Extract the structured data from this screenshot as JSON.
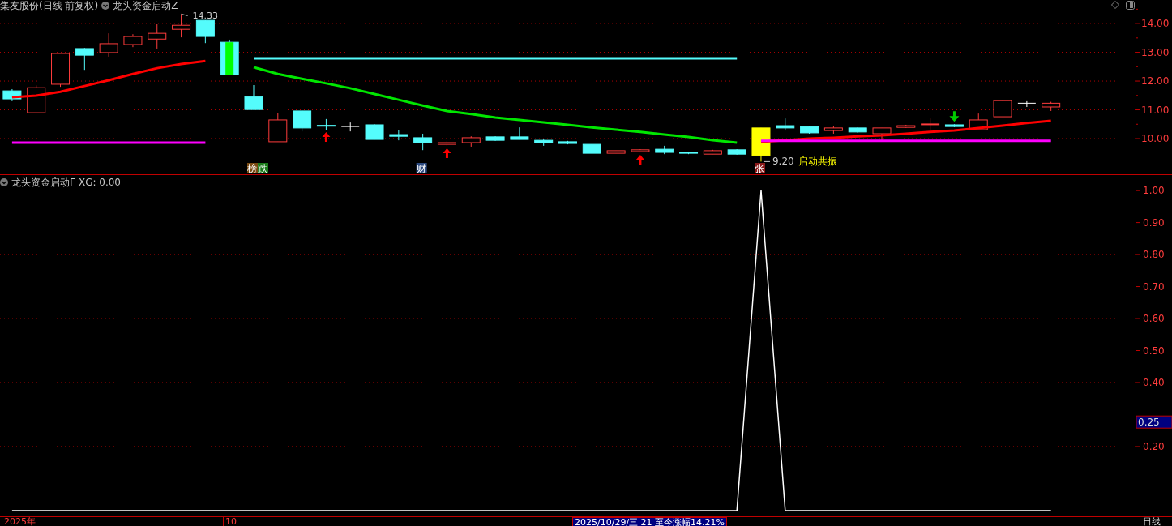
{
  "header": {
    "title": "集友股份(日线 前复权)",
    "indicator": "龙头资金启动Z"
  },
  "price_panel": {
    "chart_data": {
      "type": "line",
      "grid": true,
      "categories": [
        null,
        null,
        null,
        null,
        null,
        null,
        null,
        null,
        null,
        null,
        null,
        null,
        null,
        null,
        null,
        null,
        null,
        null,
        null,
        null,
        null,
        null,
        null,
        null,
        null,
        null,
        null,
        null,
        null,
        null,
        null,
        null,
        null,
        null,
        null,
        null,
        null,
        null,
        null,
        null,
        null,
        null,
        null,
        null,
        null,
        null,
        null
      ],
      "ylim": [
        8.76,
        14.82
      ],
      "yticks": [
        {
          "value": 10,
          "label": "10.00"
        },
        {
          "value": 11,
          "label": "11.00"
        },
        {
          "value": 12,
          "label": "12.00"
        },
        {
          "value": 13,
          "label": "13.00"
        },
        {
          "value": 14,
          "label": "14.00"
        }
      ],
      "series": [
        {
          "color": "#ff0000",
          "values": [
            11.44,
            11.49,
            11.63,
            11.83,
            12.03,
            12.25,
            12.45,
            12.59,
            12.7,
            null,
            null,
            null,
            null,
            null,
            null,
            null,
            null,
            null,
            null,
            null,
            null,
            null,
            null,
            null,
            null,
            null,
            null,
            null,
            null,
            null,
            null,
            null,
            null,
            null,
            null,
            null,
            null,
            null,
            null,
            null,
            null,
            null,
            null,
            null,
            null,
            null,
            null
          ]
        },
        {
          "color": "#00e600",
          "values": [
            null,
            null,
            null,
            null,
            null,
            null,
            null,
            null,
            null,
            null,
            12.48,
            12.25,
            12.08,
            11.92,
            11.75,
            11.55,
            11.35,
            11.15,
            10.96,
            10.85,
            10.73,
            10.65,
            10.56,
            10.48,
            10.39,
            10.31,
            10.23,
            10.14,
            10.06,
            9.94,
            9.86,
            null,
            null,
            null,
            null,
            null,
            null,
            null,
            null,
            null,
            null,
            null,
            null,
            null,
            null,
            null,
            null
          ]
        },
        {
          "color": "#ff0000",
          "values": [
            null,
            null,
            null,
            null,
            null,
            null,
            null,
            null,
            null,
            null,
            null,
            null,
            null,
            null,
            null,
            null,
            null,
            null,
            null,
            null,
            null,
            null,
            null,
            null,
            null,
            null,
            null,
            null,
            null,
            null,
            null,
            9.89,
            9.94,
            10.0,
            10.03,
            10.08,
            10.11,
            10.17,
            10.23,
            10.28,
            10.37,
            10.45,
            10.54,
            10.62,
            null,
            null,
            null
          ]
        },
        {
          "color": "#54fcfc",
          "values": [
            null,
            null,
            null,
            null,
            null,
            null,
            null,
            null,
            null,
            null,
            12.79,
            12.79,
            12.79,
            12.79,
            12.79,
            12.79,
            12.79,
            12.79,
            12.79,
            12.79,
            12.79,
            12.79,
            12.79,
            12.79,
            12.79,
            12.79,
            12.79,
            12.79,
            12.79,
            12.79,
            12.79,
            null,
            null,
            null,
            null,
            null,
            null,
            null,
            null,
            null,
            null,
            null,
            null,
            null,
            null,
            null,
            null
          ]
        },
        {
          "color": "#ff00ff",
          "values": [
            9.86,
            9.86,
            9.86,
            9.86,
            9.86,
            9.86,
            9.86,
            9.86,
            9.86,
            null,
            null,
            null,
            null,
            null,
            null,
            null,
            null,
            null,
            null,
            null,
            null,
            null,
            null,
            null,
            null,
            null,
            null,
            null,
            null,
            null,
            null,
            9.92,
            9.92,
            9.92,
            9.92,
            9.92,
            9.92,
            9.92,
            9.92,
            9.92,
            9.92,
            9.92,
            9.92,
            9.92,
            null,
            null,
            null
          ]
        }
      ]
    },
    "tags": [
      {
        "text": "榜",
        "color": "#7a4a12"
      },
      {
        "text": "跌",
        "color": "#1a7a1a"
      },
      {
        "text": "财",
        "color": "#2c4a80"
      },
      {
        "text": "张",
        "color": "#8b1a1a"
      }
    ],
    "high_label": "14.33",
    "low_label": "9.20",
    "signal_text": "启动共振"
  },
  "indicator_panel": {
    "title": "龙头资金启动F",
    "reading": "XG: 0.00",
    "current_value": "0.25",
    "chart_data": {
      "type": "line",
      "grid": true,
      "categories": [
        null,
        null,
        null,
        null,
        null,
        null,
        null,
        null,
        null,
        null,
        null,
        null,
        null,
        null,
        null,
        null,
        null,
        null,
        null,
        null,
        null,
        null,
        null,
        null,
        null,
        null,
        null,
        null,
        null,
        null,
        null,
        null,
        null,
        null,
        null,
        null,
        null,
        null,
        null,
        null,
        null,
        null,
        null,
        null,
        null,
        null,
        null
      ],
      "ylim": [
        -0.018,
        1.051
      ],
      "yticks": [
        {
          "value": 0.2,
          "label": "0.20"
        },
        {
          "value": 0.4,
          "label": "0.40"
        },
        {
          "value": 0.5,
          "label": "0.50"
        },
        {
          "value": 0.6,
          "label": "0.60"
        },
        {
          "value": 0.7,
          "label": "0.70"
        },
        {
          "value": 0.8,
          "label": "0.80"
        },
        {
          "value": 0.9,
          "label": "0.90"
        },
        {
          "value": 1.0,
          "label": "1.00"
        }
      ],
      "series": [
        {
          "color": "#ffffff",
          "values": [
            0,
            0,
            0,
            0,
            0,
            0,
            0,
            0,
            0,
            0,
            0,
            0,
            0,
            0,
            0,
            0,
            0,
            0,
            0,
            0,
            0,
            0,
            0,
            0,
            0,
            0,
            0,
            0,
            0,
            0,
            0,
            1,
            0,
            0,
            0,
            0,
            0,
            0,
            0,
            0,
            0,
            0,
            0,
            0,
            null,
            null,
            null
          ]
        }
      ]
    }
  },
  "footer": {
    "start_label": "2025年",
    "month_label": "10",
    "cursor_info": "2025/10/29/三 21 至今涨幅14.21%",
    "period": "日线"
  }
}
